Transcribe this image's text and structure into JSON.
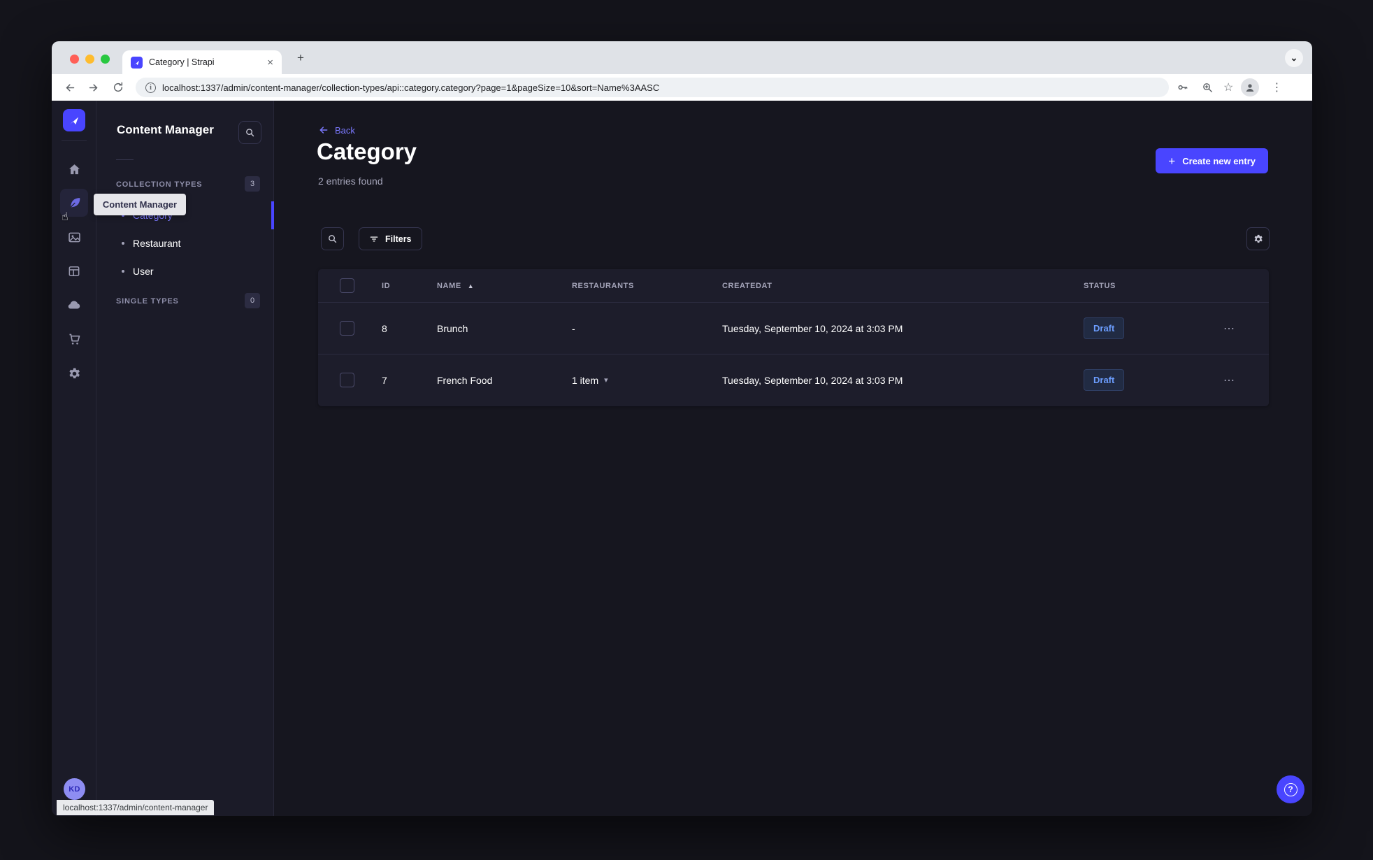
{
  "browser": {
    "tab_title": "Category | Strapi",
    "url": "localhost:1337/admin/content-manager/collection-types/api::category.category?page=1&pageSize=10&sort=Name%3AASC",
    "status_bubble": "localhost:1337/admin/content-manager"
  },
  "glyphs": {
    "close_tab": "×",
    "new_tab": "+",
    "tab_chevron": "⌄",
    "info": "i",
    "star": "☆",
    "kebab": "⋮",
    "hand_cursor": "☝",
    "plus": "+",
    "sort_asc": "▲",
    "caret_down": "▾",
    "dots": "⋯",
    "help": "?"
  },
  "nav_rail": {
    "tooltip": "Content Manager",
    "avatar_initials": "KD",
    "icons": [
      "strapi-logo",
      "home",
      "content-manager",
      "media-library",
      "layouts",
      "cloud",
      "purchases",
      "settings"
    ]
  },
  "sidebar": {
    "title": "Content Manager",
    "collection_types": {
      "label": "COLLECTION TYPES",
      "count": "3",
      "items": [
        {
          "label": "Category",
          "active": true
        },
        {
          "label": "Restaurant",
          "active": false
        },
        {
          "label": "User",
          "active": false
        }
      ]
    },
    "single_types": {
      "label": "SINGLE TYPES",
      "count": "0"
    }
  },
  "main": {
    "back_label": "Back",
    "title": "Category",
    "subtitle": "2 entries found",
    "create_button": "Create new entry",
    "filters_button": "Filters",
    "table": {
      "headers": [
        "ID",
        "NAME",
        "RESTAURANTS",
        "CREATEDAT",
        "STATUS"
      ],
      "sort": {
        "column": "NAME",
        "direction": "ascending"
      },
      "rows": [
        {
          "id": "8",
          "name": "Brunch",
          "restaurants": "-",
          "created_at": "Tuesday, September 10, 2024 at 3:03 PM",
          "status": "Draft"
        },
        {
          "id": "7",
          "name": "French Food",
          "restaurants": "1 item",
          "created_at": "Tuesday, September 10, 2024 at 3:03 PM",
          "status": "Draft"
        }
      ]
    }
  },
  "colors": {
    "accent": "#4945ff",
    "accent_text": "#7b79ff",
    "draft_text": "#6c9eff",
    "page_bg": "#16161f",
    "panel_bg": "#1b1b28",
    "border": "#2c2c40"
  }
}
